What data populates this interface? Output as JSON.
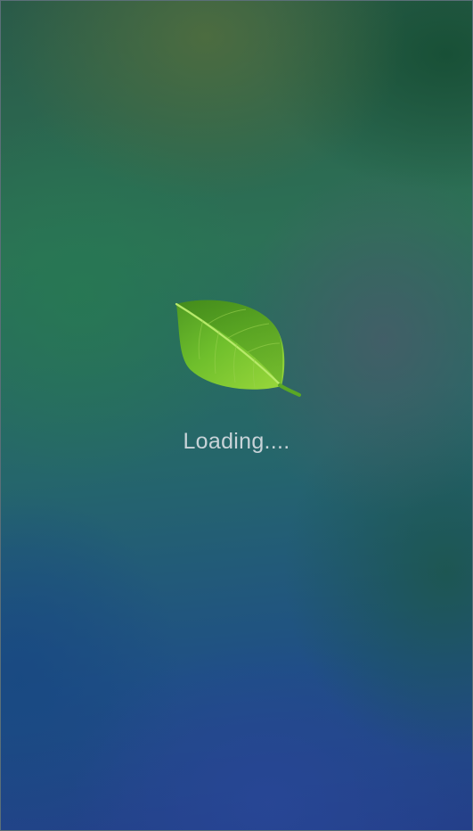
{
  "splash": {
    "logo_icon": "leaf-icon",
    "loading_text": "Loading....",
    "colors": {
      "leaf_light": "#8dd63a",
      "leaf_dark": "#3f8a1a",
      "text": "#c8d3d8"
    }
  }
}
